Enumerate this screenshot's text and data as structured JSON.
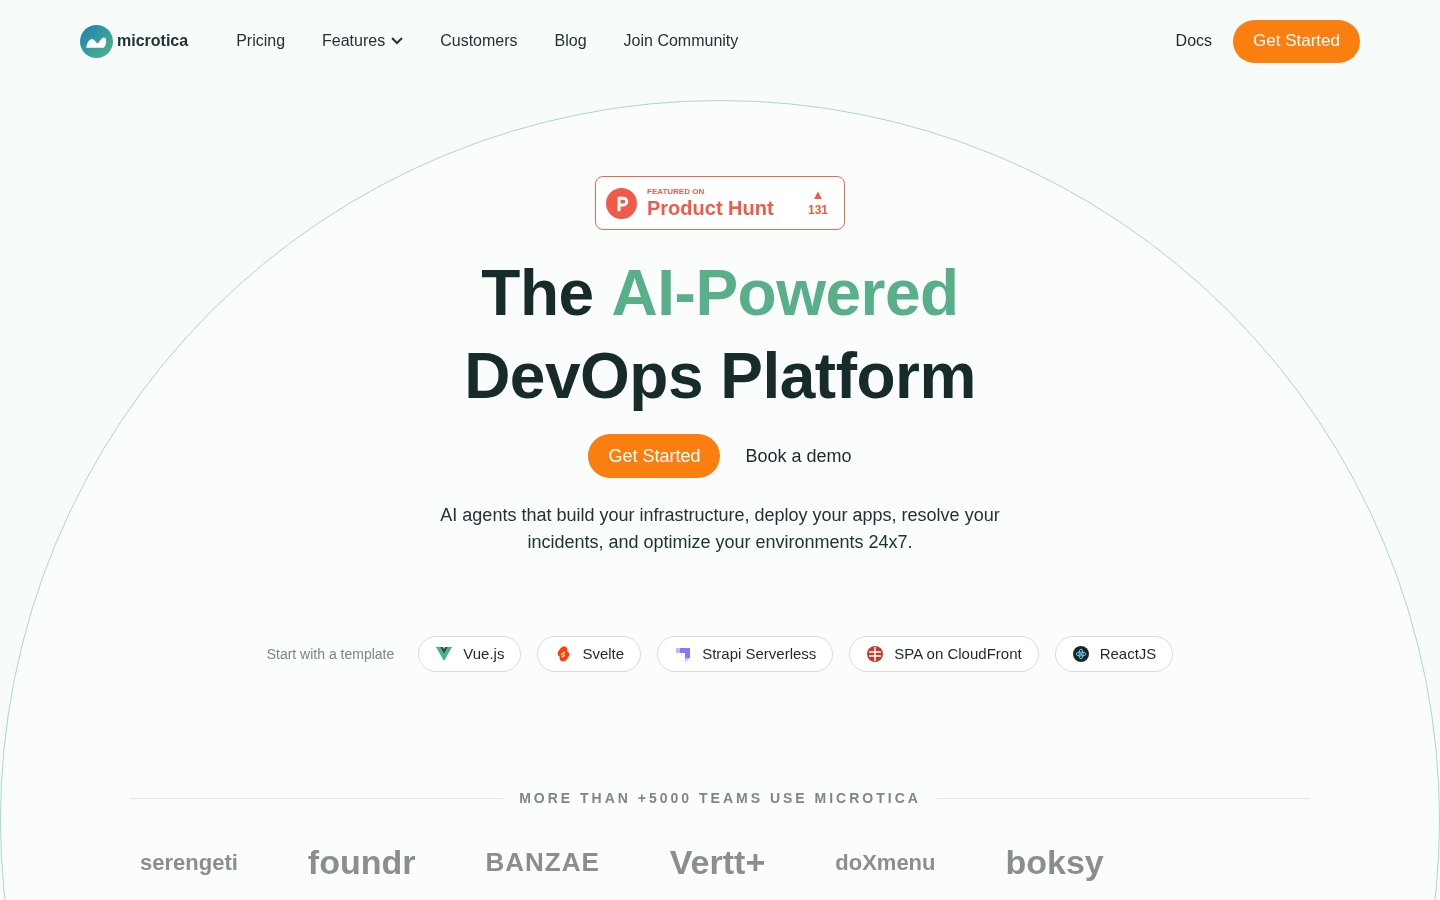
{
  "nav": {
    "brand": "microtica",
    "links": [
      {
        "label": "Pricing",
        "dropdown": false
      },
      {
        "label": "Features",
        "dropdown": true
      },
      {
        "label": "Customers",
        "dropdown": false
      },
      {
        "label": "Blog",
        "dropdown": false
      },
      {
        "label": "Join Community",
        "dropdown": false
      }
    ],
    "docs": "Docs",
    "cta": "Get Started"
  },
  "badge": {
    "overline": "FEATURED ON",
    "title": "Product Hunt",
    "upvote_icon": "▲",
    "count": "131"
  },
  "hero": {
    "title_lines": [
      {
        "parts": [
          {
            "text": "The",
            "accent": false
          },
          {
            "text": "AI-Powered",
            "accent": true
          }
        ]
      },
      {
        "parts": [
          {
            "text": "DevOps Platform",
            "accent": false
          }
        ]
      }
    ],
    "primary": "Get Started",
    "secondary": "Book a demo",
    "subtitle": "AI agents that build your infrastructure, deploy your apps, resolve your incidents, and optimize your environments 24x7."
  },
  "templates": {
    "label": "Start with a template",
    "items": [
      {
        "label": "Vue.js",
        "kind": "vue"
      },
      {
        "label": "Svelte",
        "kind": "svelte"
      },
      {
        "label": "Strapi Serverless",
        "kind": "strapi"
      },
      {
        "label": "SPA on CloudFront",
        "kind": "aws"
      },
      {
        "label": "ReactJS",
        "kind": "react"
      }
    ]
  },
  "customers": {
    "heading": "MORE THAN +5000 TEAMS USE MICROTICA",
    "logos": [
      {
        "text": "serengeti",
        "kind": "small"
      },
      {
        "text": "foundr",
        "kind": "bold"
      },
      {
        "text": "BANZAE",
        "kind": "wide"
      },
      {
        "text": "Vertt+",
        "kind": "bold"
      },
      {
        "text": "doXmenu",
        "kind": "small"
      },
      {
        "text": "boksy",
        "kind": "bold"
      }
    ]
  }
}
